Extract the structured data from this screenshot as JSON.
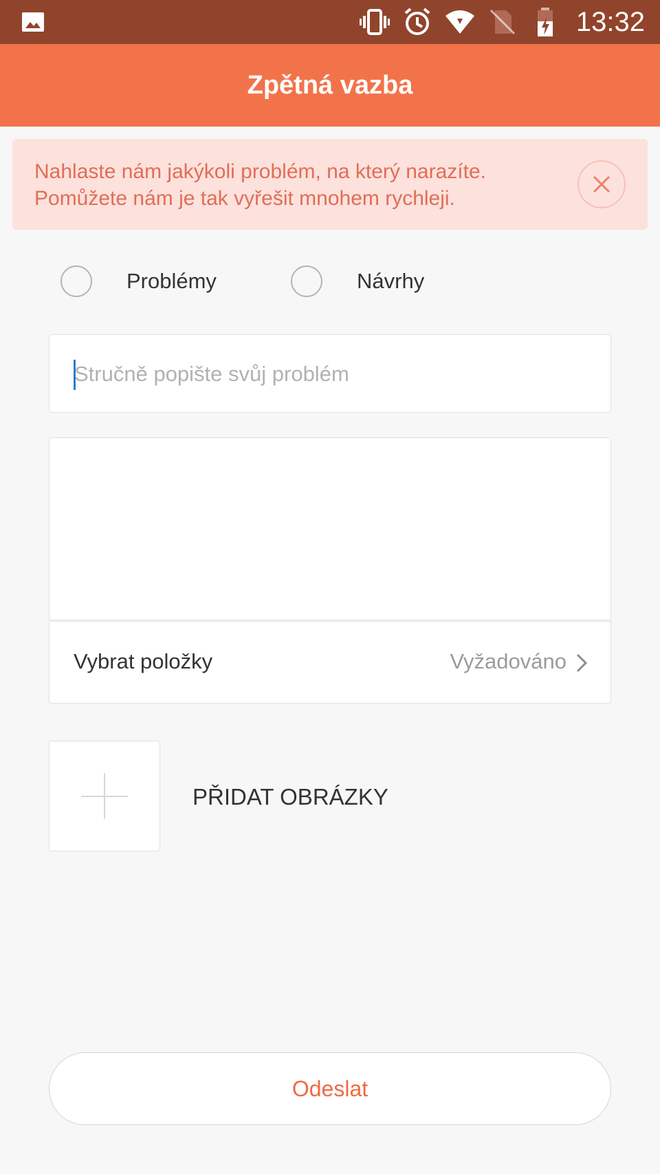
{
  "status_bar": {
    "time": "13:32",
    "icons": [
      "gallery-icon",
      "vibrate-icon",
      "alarm-icon",
      "wifi-icon",
      "no-sim-icon",
      "battery-charging-icon"
    ]
  },
  "app_bar": {
    "title": "Zpětná vazba"
  },
  "banner": {
    "line1": "Nahlaste nám jakýkoli problém, na který narazíte.",
    "line2": "Pomůžete nám je tak vyřešit mnohem rychleji.",
    "close_icon": "close-icon"
  },
  "feedback_type": {
    "options": [
      {
        "label": "Problémy",
        "selected": false
      },
      {
        "label": "Návrhy",
        "selected": false
      }
    ]
  },
  "summary": {
    "placeholder": "Stručně popište svůj problém",
    "value": ""
  },
  "details": {
    "value": ""
  },
  "select_items": {
    "label": "Vybrat položky",
    "value": "Vyžadováno"
  },
  "attachments": {
    "label": "PŘIDAT OBRÁZKY"
  },
  "submit": {
    "label": "Odeslat"
  },
  "colors": {
    "status_bar": "#91442c",
    "app_bar": "#f2734a",
    "banner_bg": "#fde1dc",
    "banner_text": "#e06e57",
    "accent": "#ee6b43"
  }
}
